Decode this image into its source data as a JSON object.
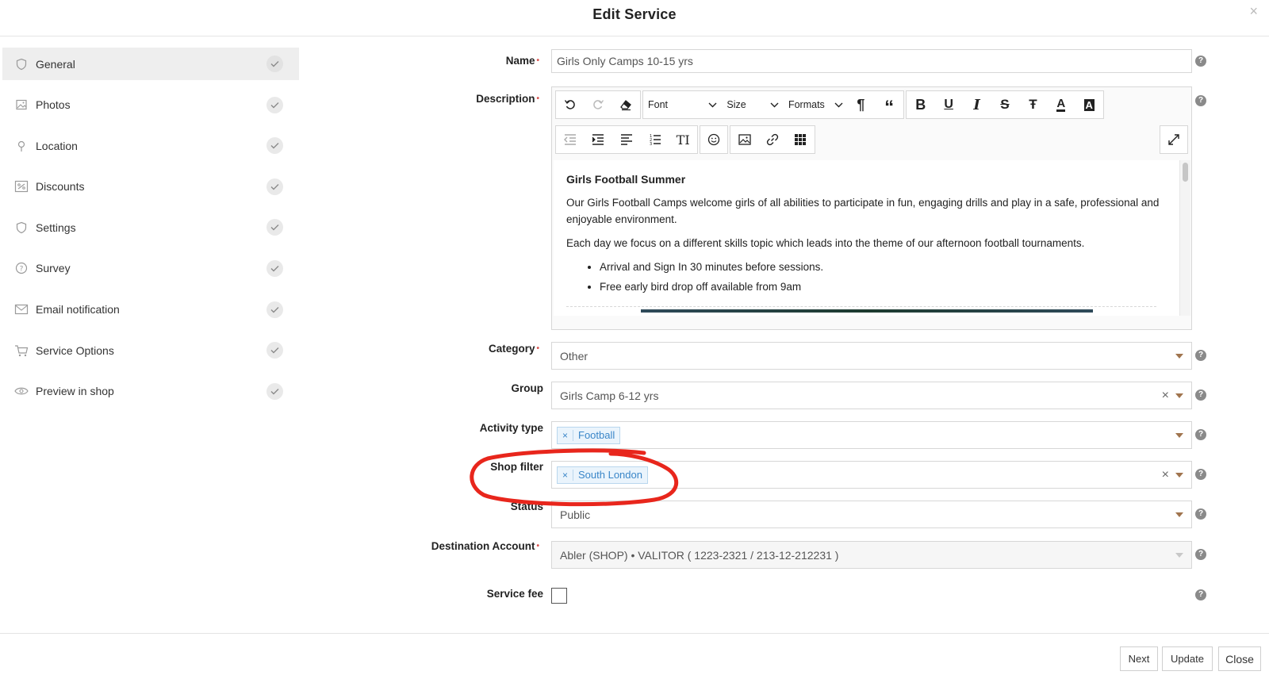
{
  "modal": {
    "title": "Edit Service",
    "close_glyph": "×"
  },
  "sidebar": {
    "items": [
      {
        "label": "General",
        "icon": "shield-icon",
        "active": true
      },
      {
        "label": "Photos",
        "icon": "image-icon"
      },
      {
        "label": "Location",
        "icon": "pin-icon"
      },
      {
        "label": "Discounts",
        "icon": "percent-icon"
      },
      {
        "label": "Settings",
        "icon": "shield-icon"
      },
      {
        "label": "Survey",
        "icon": "question-icon"
      },
      {
        "label": "Email notification",
        "icon": "mail-icon"
      },
      {
        "label": "Service Options",
        "icon": "cart-icon"
      },
      {
        "label": "Preview in shop",
        "icon": "eye-icon"
      }
    ]
  },
  "form": {
    "name": {
      "label": "Name",
      "value": "Girls Only Camps 10-15 yrs"
    },
    "description": {
      "label": "Description",
      "toolbar": {
        "font": "Font",
        "size": "Size",
        "formats": "Formats"
      },
      "heading": "Girls Football Summer",
      "paragraph1": "Our Girls Football Camps welcome girls of all abilities to participate in fun, engaging drills and play in a safe, professional and enjoyable environment.",
      "paragraph2": "Each day we focus on a different skills topic which leads into the theme of our afternoon football tournaments.",
      "bullets": [
        "Arrival and Sign In 30 minutes before sessions.",
        "Free early bird drop off available from 9am"
      ]
    },
    "category": {
      "label": "Category",
      "value": "Other"
    },
    "group": {
      "label": "Group",
      "value": "Girls Camp 6-12 yrs"
    },
    "activity_type": {
      "label": "Activity type",
      "tag": "Football"
    },
    "shop_filter": {
      "label": "Shop filter",
      "tag": "South London"
    },
    "status": {
      "label": "Status",
      "value": "Public"
    },
    "destination_account": {
      "label": "Destination Account",
      "value": "Abler (SHOP) • VALITOR ( 1223-2321 / 213-12-212231 )"
    },
    "service_fee": {
      "label": "Service fee",
      "checked": false
    },
    "help_glyph": "?",
    "required_marker": "•",
    "tag_remove_glyph": "×",
    "clear_glyph": "×"
  },
  "footer": {
    "next": "Next",
    "update": "Update",
    "close": "Close"
  },
  "colors": {
    "tag_bg": "#eaf4fc",
    "tag_text": "#3a86c8",
    "caret": "#a0744e",
    "annotation": "#e8261c"
  }
}
